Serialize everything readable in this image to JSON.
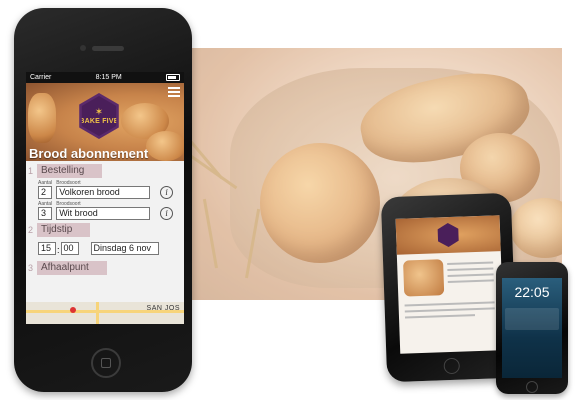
{
  "status_bar": {
    "carrier": "Carrier",
    "time": "8:15 PM"
  },
  "brand": {
    "logo_text": "BAKE FIVE",
    "accent_color": "#5b2a6b",
    "logo_text_color": "#f0c248"
  },
  "hero": {
    "title": "Brood abonnement"
  },
  "sections": [
    {
      "number": "1",
      "label": "Bestelling"
    },
    {
      "number": "2",
      "label": "Tijdstip"
    },
    {
      "number": "3",
      "label": "Afhaalpunt"
    }
  ],
  "order": {
    "amount_caption": "Aantal",
    "type_caption": "Broodsoort",
    "items": [
      {
        "amount": "2",
        "bread": "Volkoren brood",
        "info_icon": "info-icon"
      },
      {
        "amount": "3",
        "bread": "Wit brood",
        "info_icon": "info-icon"
      }
    ]
  },
  "time_slot": {
    "hour": "15",
    "minute": "00",
    "day": "Dinsdag 6 nov"
  },
  "map": {
    "city_label": "SAN JOS"
  },
  "lock_screen": {
    "time": "22:05"
  }
}
